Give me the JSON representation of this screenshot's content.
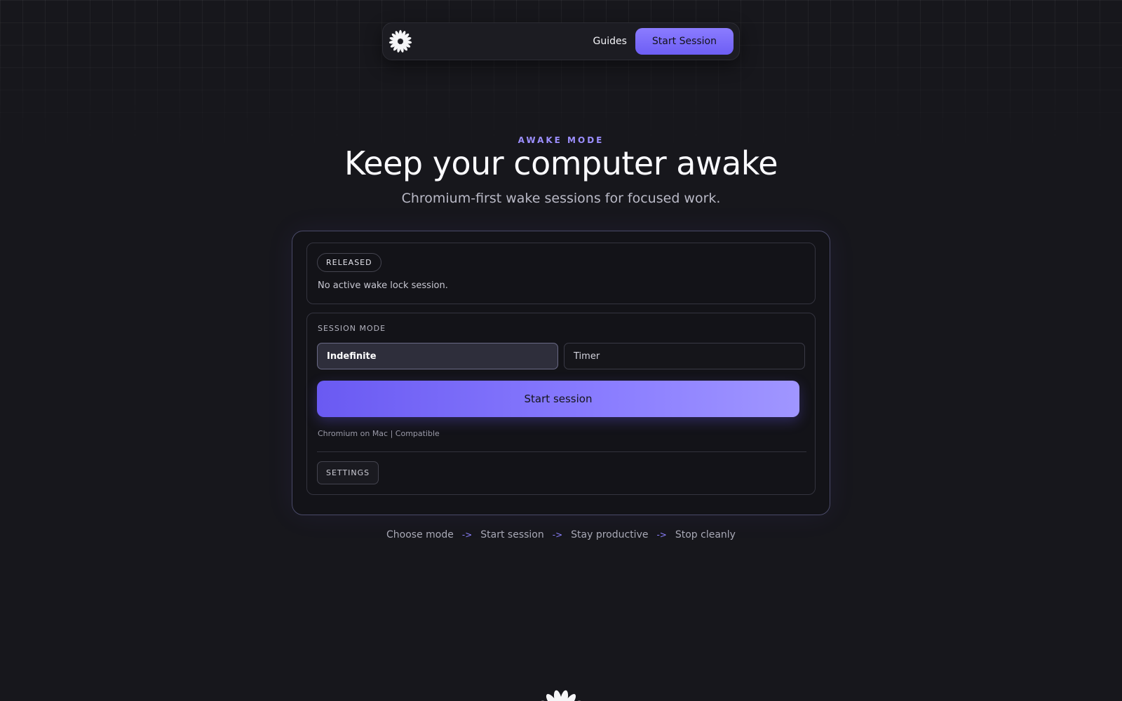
{
  "nav": {
    "logo_icon": "flower-burst-icon",
    "guides_label": "Guides",
    "cta_label": "Start Session"
  },
  "hero": {
    "eyebrow": "AWAKE MODE",
    "title": "Keep your computer awake",
    "subtitle": "Chromium-first wake sessions for focused work."
  },
  "status": {
    "badge": "RELEASED",
    "message": "No active wake lock session."
  },
  "session": {
    "label": "SESSION MODE",
    "modes": [
      {
        "label": "Indefinite",
        "selected": true
      },
      {
        "label": "Timer",
        "selected": false
      }
    ],
    "start_label": "Start session",
    "compat_text": "Chromium on Mac | Compatible",
    "settings_label": "SETTINGS"
  },
  "steps": [
    "Choose mode",
    "Start session",
    "Stay productive",
    "Stop cleanly"
  ],
  "step_separator": "->",
  "colors": {
    "background": "#17171c",
    "accent": "#7b6cff",
    "accent_text": "#9c8fff"
  }
}
